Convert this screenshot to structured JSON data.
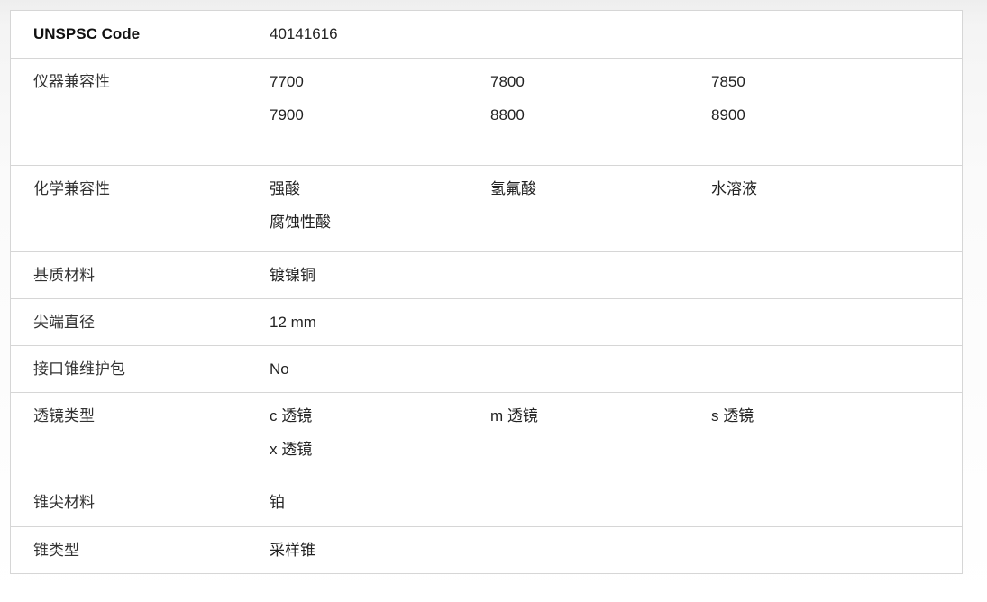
{
  "specs": [
    {
      "label": "UNSPSC Code",
      "bold": true,
      "values": [
        "40141616"
      ]
    },
    {
      "label": "仪器兼容性",
      "values": [
        "7700",
        "7800",
        "7850",
        "7900",
        "8800",
        "8900"
      ]
    },
    {
      "label": "化学兼容性",
      "values": [
        "强酸",
        "氢氟酸",
        "水溶液",
        "腐蚀性酸"
      ]
    },
    {
      "label": "基质材料",
      "values": [
        "镀镍铜"
      ]
    },
    {
      "label": "尖端直径",
      "values": [
        "12 mm"
      ]
    },
    {
      "label": "接口锥维护包",
      "values": [
        "No"
      ]
    },
    {
      "label": "透镜类型",
      "values": [
        "c 透镜",
        "m 透镜",
        "s 透镜",
        "x 透镜"
      ]
    },
    {
      "label": "锥尖材料",
      "values": [
        "铂"
      ]
    },
    {
      "label": "锥类型",
      "values": [
        "采样锥"
      ]
    }
  ]
}
